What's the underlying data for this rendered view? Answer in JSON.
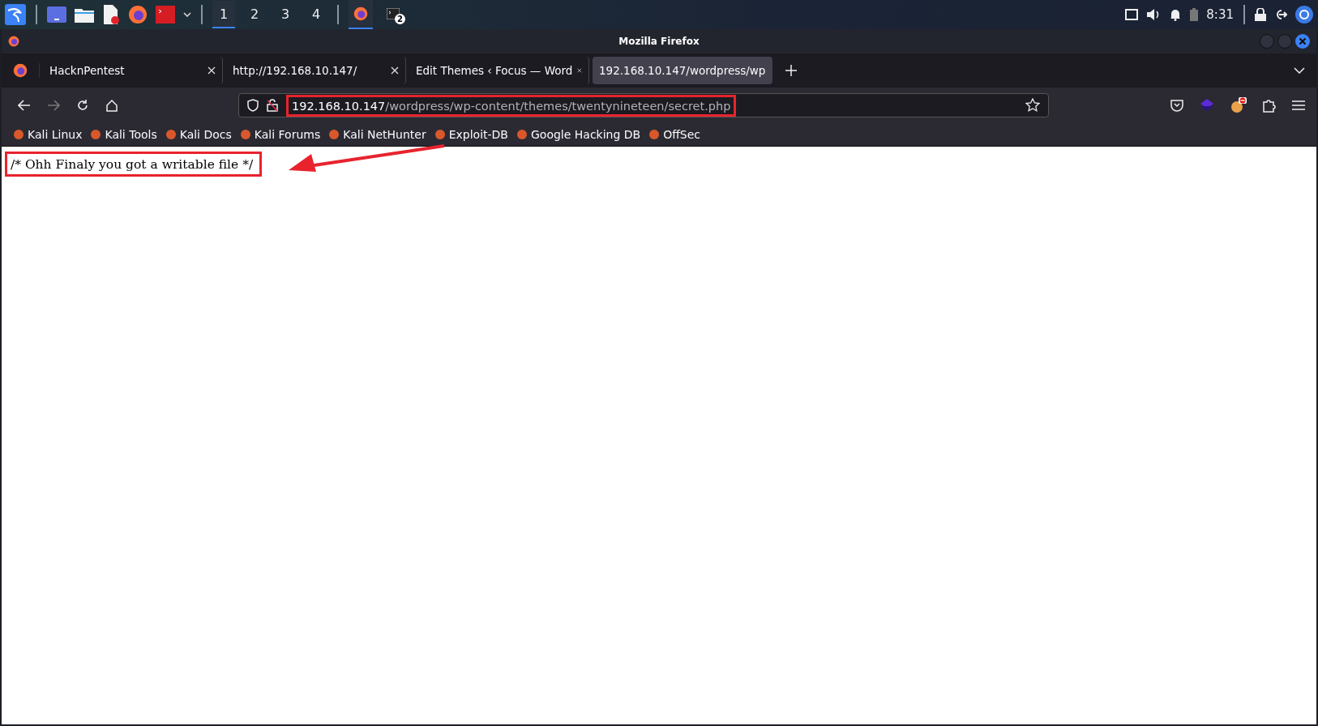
{
  "taskbar": {
    "workspaces": [
      {
        "label": "1",
        "selected": true
      },
      {
        "label": "2",
        "selected": false
      },
      {
        "label": "3",
        "selected": false
      },
      {
        "label": "4",
        "selected": false
      }
    ],
    "tasks": [
      {
        "kind": "firefox",
        "selected": true
      },
      {
        "kind": "terminal",
        "selected": false,
        "badge": "2"
      }
    ],
    "clock": "8:31"
  },
  "window": {
    "title": "Mozilla Firefox"
  },
  "tabs": [
    {
      "label": "HacknPentest",
      "selected": false
    },
    {
      "label": "http://192.168.10.147/",
      "selected": false
    },
    {
      "label": "Edit Themes ‹ Focus — Word",
      "selected": false
    },
    {
      "label": "192.168.10.147/wordpress/wp",
      "selected": true
    }
  ],
  "address_bar": {
    "host": "192.168.10.147",
    "path": "/wordpress/wp-content/themes/twentynineteen/secret.php"
  },
  "bookmarks": [
    "Kali Linux",
    "Kali Tools",
    "Kali Docs",
    "Kali Forums",
    "Kali NetHunter",
    "Exploit-DB",
    "Google Hacking DB",
    "OffSec"
  ],
  "page": {
    "text": "/* Ohh Finaly you got a writable file */"
  }
}
